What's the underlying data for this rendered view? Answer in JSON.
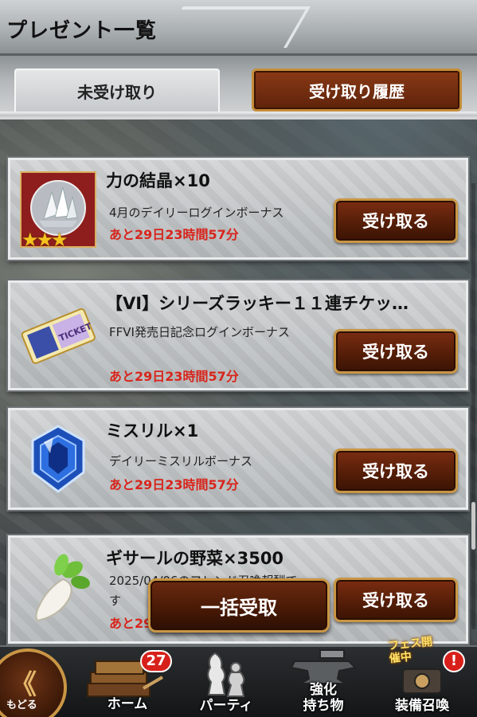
{
  "header": {
    "title": "プレゼント一覧"
  },
  "tabs": [
    {
      "label": "未受け取り",
      "active": true
    },
    {
      "label": "受け取り履歴",
      "active": false
    }
  ],
  "items": [
    {
      "title": "力の結晶×10",
      "desc": "4月のデイリーログインボーナス",
      "deadline": "あと29日23時間57分",
      "button": "受け取る",
      "icon": "crystal-icon",
      "stars": "★★★"
    },
    {
      "title": "【VI】シリーズラッキー１１連チケッ…",
      "desc": "FFVI発売日記念ログインボーナス",
      "deadline": "あと29日23時間57分",
      "button": "受け取る",
      "icon": "ticket-icon",
      "ticket_text": "TICKET"
    },
    {
      "title": "ミスリル×1",
      "desc": "デイリーミスリルボーナス",
      "deadline": "あと29日23時間57分",
      "button": "受け取る",
      "icon": "mythril-gem-icon"
    },
    {
      "title": "ギサールの野菜×3500",
      "desc": "2025/04/06のフレンド召喚報酬です",
      "deadline": "あと29日23時間57分",
      "button": "受け取る",
      "icon": "gysahl-greens-icon"
    }
  ],
  "bulk_receive": {
    "label": "一括受取"
  },
  "bottom_nav": {
    "back": {
      "label": "もどる",
      "glyph": "《"
    },
    "items": [
      {
        "label": "ホーム",
        "badge": "27",
        "icon": "home-books-icon"
      },
      {
        "label": "パーティ",
        "icon": "chess-pieces-icon"
      },
      {
        "label": "強化\n持ち物",
        "icon": "anvil-icon"
      },
      {
        "label": "装備召喚",
        "badge": "!",
        "banner": "フェス開催中",
        "icon": "summon-icon"
      }
    ]
  },
  "colors": {
    "accent_gold": "#c99645",
    "button_brown": "#561e08",
    "deadline_red": "#d8251c"
  }
}
